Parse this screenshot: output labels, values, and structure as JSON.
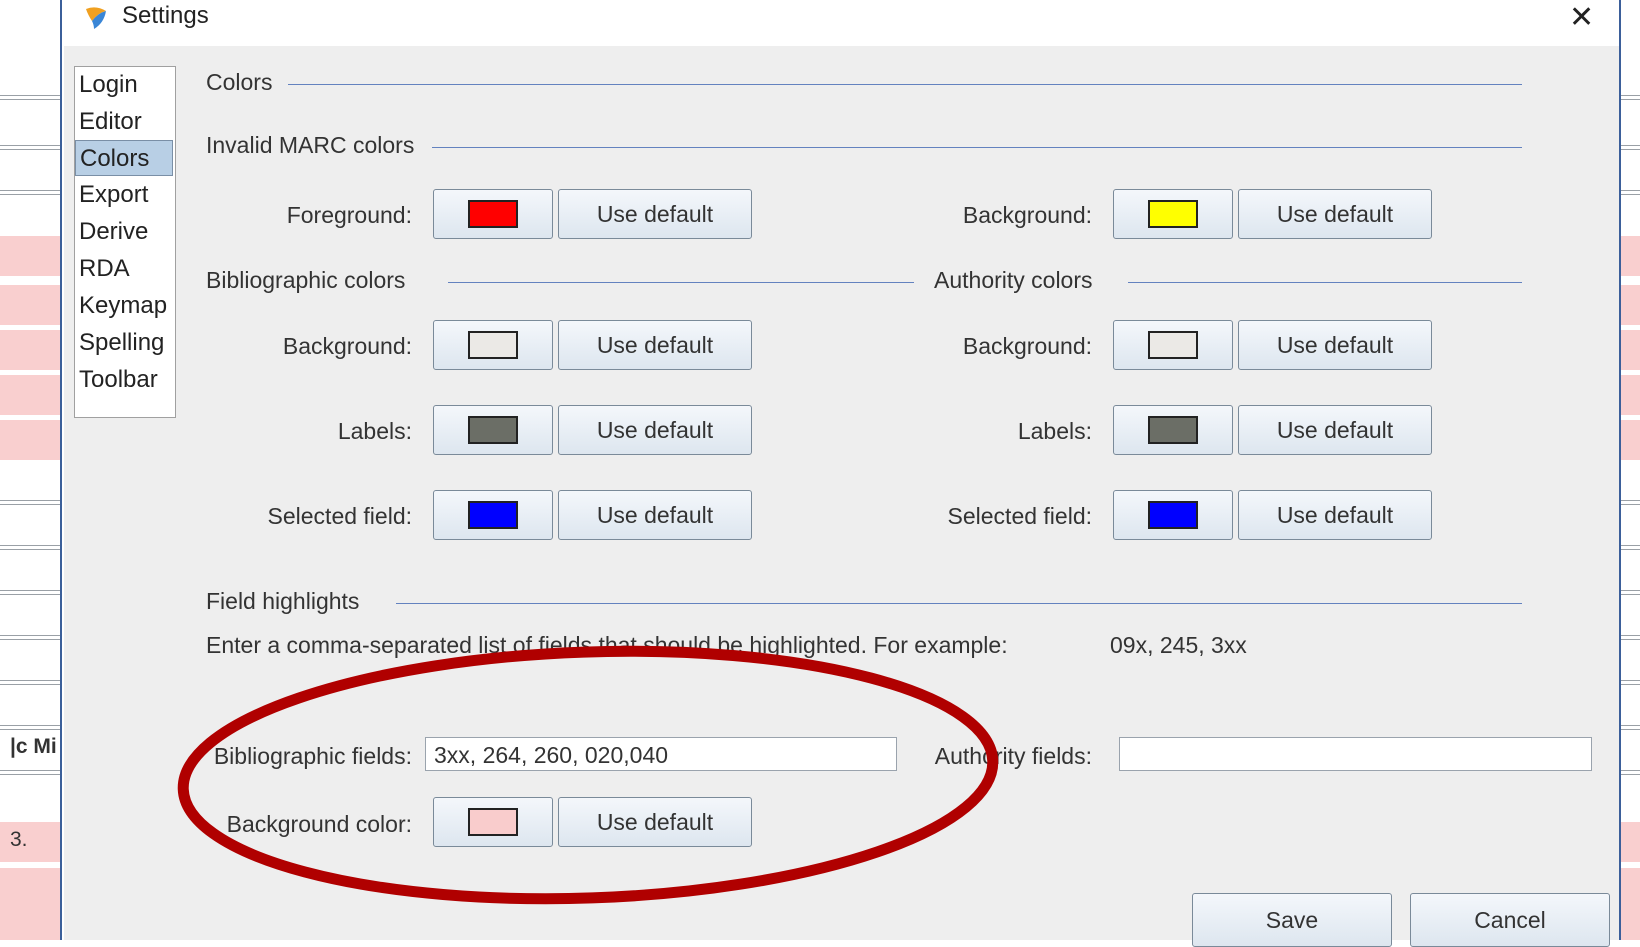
{
  "background": {
    "row_text_1": "|c Mi",
    "row_text_2": "3."
  },
  "dialog": {
    "title": "Settings",
    "close_glyph": "✕",
    "nav": [
      "Login",
      "Editor",
      "Colors",
      "Export",
      "Derive",
      "RDA",
      "Keymap",
      "Spelling",
      "Toolbar"
    ],
    "selected_nav": "Colors",
    "colors_title": "Colors",
    "invalid_marc": {
      "title": "Invalid MARC colors",
      "foreground_label": "Foreground:",
      "background_label": "Background:",
      "foreground_color": "#ff0000",
      "background_color": "#ffff00"
    },
    "bibliographic": {
      "title": "Bibliographic colors",
      "background_label": "Background:",
      "labels_label": "Labels:",
      "selected_label": "Selected field:",
      "background_color": "#ebe9e6",
      "labels_color": "#6b6e66",
      "selected_color": "#0000ff"
    },
    "authority": {
      "title": "Authority colors",
      "background_label": "Background:",
      "labels_label": "Labels:",
      "selected_label": "Selected field:",
      "background_color": "#ebe9e6",
      "labels_color": "#6b6e66",
      "selected_color": "#0000ff"
    },
    "use_default_label": "Use default",
    "field_highlights": {
      "title": "Field highlights",
      "hint": "Enter a comma-separated list of fields that should be highlighted. For example:",
      "example": "09x, 245, 3xx",
      "bib_label": "Bibliographic fields:",
      "bib_value": "3xx, 264, 260, 020,040",
      "auth_label": "Authority fields:",
      "auth_value": "",
      "bgcolor_label": "Background color:",
      "bgcolor": "#f9cccc"
    },
    "save_label": "Save",
    "cancel_label": "Cancel",
    "annotation_color": "#b00000"
  }
}
